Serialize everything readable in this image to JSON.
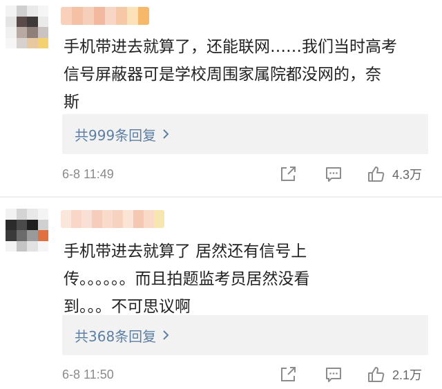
{
  "colors": {
    "link": "#5d7fa3",
    "reply_bg": "#f2f2f2",
    "meta_gray": "#8a8a8a",
    "icon_gray": "#8c8c8c"
  },
  "icons": [
    "share-icon",
    "comment-icon",
    "like-icon",
    "chevron-right-icon"
  ],
  "comments": [
    {
      "text": "手机带进去就算了，还能联网……我们当时高考\n信号屏蔽器可是学校周围家属院都没网的，奈\n斯",
      "replies_label": "共999条回复",
      "timestamp": "6-8 11:49",
      "likes": "4.3万"
    },
    {
      "text": "手机带进去就算了 居然还有信号上\n传。。。。。。而且拍题监考员居然没看\n到。。。不可思议啊",
      "replies_label": "共368条回复",
      "timestamp": "6-8 11:50",
      "likes": "2.1万"
    }
  ]
}
